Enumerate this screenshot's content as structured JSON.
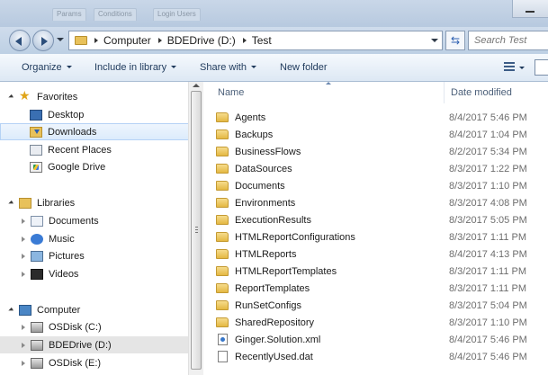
{
  "title_tabs": [
    "Params",
    "Conditions",
    "Login Users"
  ],
  "address": {
    "crumbs": [
      "Computer",
      "BDEDrive (D:)",
      "Test"
    ]
  },
  "search": {
    "placeholder": "Search Test"
  },
  "toolbar": {
    "organize": "Organize",
    "include": "Include in library",
    "share": "Share with",
    "new_folder": "New folder"
  },
  "nav": {
    "favorites": "Favorites",
    "desktop": "Desktop",
    "downloads": "Downloads",
    "recent": "Recent Places",
    "gdrive": "Google Drive",
    "libraries": "Libraries",
    "documents": "Documents",
    "music": "Music",
    "pictures": "Pictures",
    "videos": "Videos",
    "computer": "Computer",
    "osdisk_c": "OSDisk (C:)",
    "bdedrive": "BDEDrive (D:)",
    "osdisk_e": "OSDisk (E:)"
  },
  "columns": {
    "name": "Name",
    "date": "Date modified"
  },
  "files": [
    {
      "name": "Agents",
      "date": "8/4/2017 5:46 PM",
      "icon": "folder-icon"
    },
    {
      "name": "Backups",
      "date": "8/4/2017 1:04 PM",
      "icon": "folder-icon"
    },
    {
      "name": "BusinessFlows",
      "date": "8/2/2017 5:34 PM",
      "icon": "folder-icon"
    },
    {
      "name": "DataSources",
      "date": "8/3/2017 1:22 PM",
      "icon": "folder-icon"
    },
    {
      "name": "Documents",
      "date": "8/3/2017 1:10 PM",
      "icon": "folder-icon"
    },
    {
      "name": "Environments",
      "date": "8/3/2017 4:08 PM",
      "icon": "folder-icon"
    },
    {
      "name": "ExecutionResults",
      "date": "8/3/2017 5:05 PM",
      "icon": "folder-icon"
    },
    {
      "name": "HTMLReportConfigurations",
      "date": "8/3/2017 1:11 PM",
      "icon": "folder-icon"
    },
    {
      "name": "HTMLReports",
      "date": "8/4/2017 4:13 PM",
      "icon": "folder-icon"
    },
    {
      "name": "HTMLReportTemplates",
      "date": "8/3/2017 1:11 PM",
      "icon": "folder-icon"
    },
    {
      "name": "ReportTemplates",
      "date": "8/3/2017 1:11 PM",
      "icon": "folder-icon"
    },
    {
      "name": "RunSetConfigs",
      "date": "8/3/2017 5:04 PM",
      "icon": "folder-icon"
    },
    {
      "name": "SharedRepository",
      "date": "8/3/2017 1:10 PM",
      "icon": "folder-icon"
    },
    {
      "name": "Ginger.Solution.xml",
      "date": "8/4/2017 5:46 PM",
      "icon": "xml-file-icon"
    },
    {
      "name": "RecentlyUsed.dat",
      "date": "8/4/2017 5:46 PM",
      "icon": "dat-file-icon"
    }
  ]
}
